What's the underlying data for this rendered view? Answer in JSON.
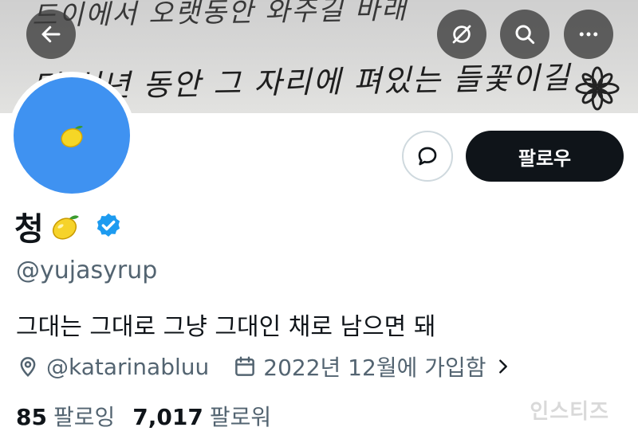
{
  "banner": {
    "line_top": "드이에서 오랫동안 와주길 바래",
    "line_main": "몇 십년 동안 그 자리에 펴있는 들꽃이길 -"
  },
  "header_buttons": {
    "back_icon": "arrow-left-icon",
    "translate_icon": "translate-globe-icon",
    "search_icon": "search-icon",
    "more_icon": "more-horizontal-icon"
  },
  "profile": {
    "display_name": "청",
    "handle": "@yujasyrup",
    "bio": "그대는 그대로 그냥 그대인 채로 남으면 돼",
    "location": "@katarinabluu",
    "joined": "2022년 12월에 가입함",
    "following_count": "85",
    "following_label": "팔로잉",
    "followers_count": "7,017",
    "followers_label": "팔로워"
  },
  "actions": {
    "follow_label": "팔로우",
    "message_icon": "message-bubble-icon"
  },
  "watermark": "인스티즈",
  "colors": {
    "avatar_bg": "#3f92f1",
    "verified_blue": "#1d9bf0",
    "follow_bg": "#0f1419",
    "muted_text": "#536471"
  }
}
